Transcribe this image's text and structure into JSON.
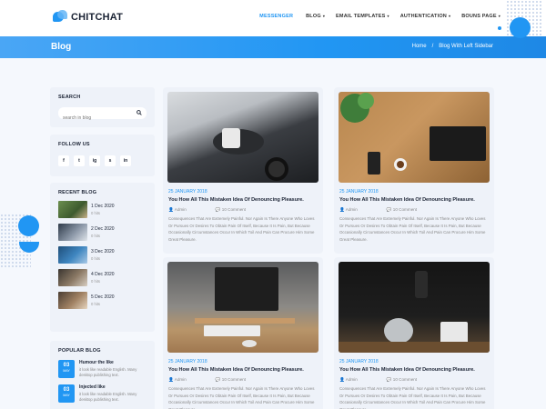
{
  "brand": {
    "name": "CHITCHAT"
  },
  "nav": {
    "items": [
      {
        "label": "MESSENGER",
        "caret": ""
      },
      {
        "label": "BLOG",
        "caret": "▾"
      },
      {
        "label": "EMAIL TEMPLATES",
        "caret": "▾"
      },
      {
        "label": "AUTHENTICATION",
        "caret": "▾"
      },
      {
        "label": "BOUNS PAGE",
        "caret": "▾"
      }
    ]
  },
  "banner": {
    "title": "Blog",
    "breadcrumb": [
      "Home",
      "/",
      "Blog With Left Sidebar"
    ]
  },
  "sidebar": {
    "search": {
      "title": "SEARCH",
      "placeholder": "search in blog",
      "value": ""
    },
    "follow": {
      "title": "FOLLOW US",
      "icons": [
        "f",
        "t",
        "ig",
        "s",
        "in"
      ]
    },
    "recent": {
      "title": "RECENT BLOG",
      "items": [
        {
          "date": "1 Dec 2020",
          "sub": "0 hits"
        },
        {
          "date": "2 Dec 2020",
          "sub": "0 hits"
        },
        {
          "date": "3 Dec 2020",
          "sub": "0 hits"
        },
        {
          "date": "4 Dec 2020",
          "sub": "0 hits"
        },
        {
          "date": "5 Dec 2020",
          "sub": "0 hits"
        }
      ]
    },
    "popular": {
      "title": "POPULAR BLOG",
      "items": [
        {
          "day": "03",
          "month": "MAY",
          "title": "Humour the like",
          "text": "it look like readable English. Many desktop publishing text."
        },
        {
          "day": "03",
          "month": "MAY",
          "title": "Injected like",
          "text": "it look like readable English. Many desktop publishing text."
        }
      ]
    }
  },
  "posts": [
    {
      "date": "25 JANUARY 2018",
      "title": "You How All This Mistaken Idea Of Denouncing Pleasure.",
      "author": "Admin",
      "comments": "10 Comment",
      "excerpt": "Consequences That Are Extremely Painful. Nor Again Is There Anyone Who Loves Or Pursues Or Desires To Obtain Pain Of Itself, Because It Is Pain, But Because Occasionally Circumstances Occur In Which Toil And Pain Can Procure Him Some Great Pleasure."
    },
    {
      "date": "25 JANUARY 2018",
      "title": "You How All This Mistaken Idea Of Denouncing Pleasure.",
      "author": "Admin",
      "comments": "10 Comment",
      "excerpt": "Consequences That Are Extremely Painful. Nor Again Is There Anyone Who Loves Or Pursues Or Desires To Obtain Pain Of Itself, Because It Is Pain, But Because Occasionally Circumstances Occur In Which Toil And Pain Can Procure Him Some Great Pleasure."
    },
    {
      "date": "25 JANUARY 2018",
      "title": "You How All This Mistaken Idea Of Denouncing Pleasure.",
      "author": "Admin",
      "comments": "10 Comment",
      "excerpt": "Consequences That Are Extremely Painful. Nor Again Is There Anyone Who Loves Or Pursues Or Desires To Obtain Pain Of Itself, Because It Is Pain, But Because Occasionally Circumstances Occur In Which Toil And Pain Can Procure Him Some Great Pleasure."
    },
    {
      "date": "25 JANUARY 2018",
      "title": "You How All This Mistaken Idea Of Denouncing Pleasure.",
      "author": "Admin",
      "comments": "10 Comment",
      "excerpt": "Consequences That Are Extremely Painful. Nor Again Is There Anyone Who Loves Or Pursues Or Desires To Obtain Pain Of Itself, Because It Is Pain, But Because Occasionally Circumstances Occur In Which Toil And Pain Can Procure Him Some Great Pleasure."
    }
  ],
  "colors": {
    "accent": "#2196f3",
    "bg": "#f5f8fd",
    "card": "#eef2f9",
    "text": "#1a2233"
  }
}
